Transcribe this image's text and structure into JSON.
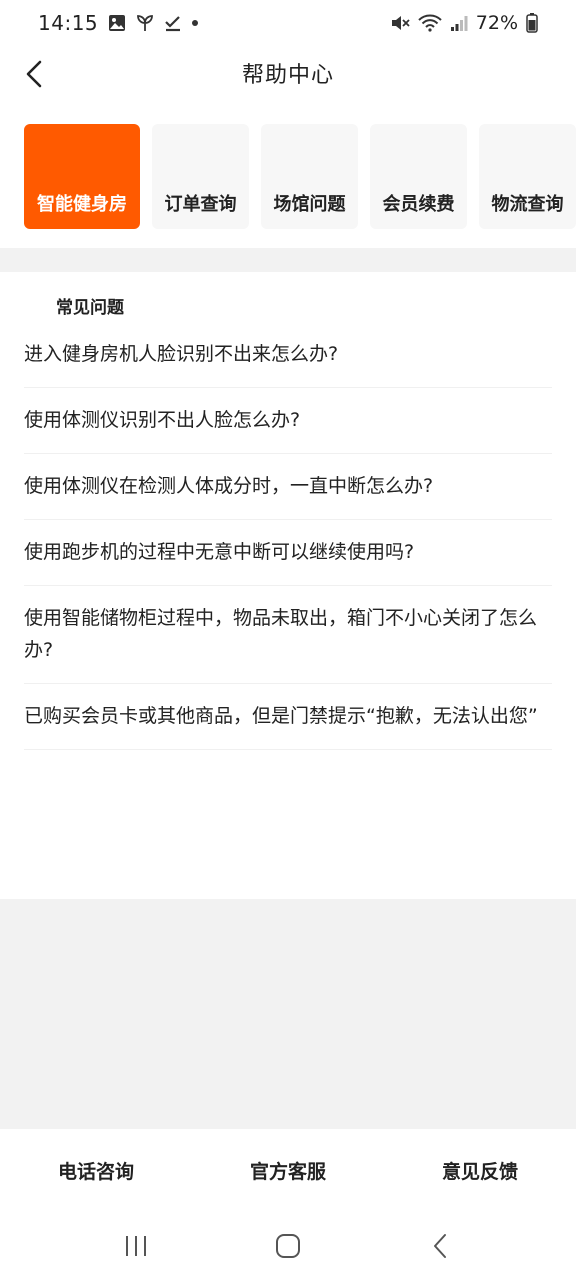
{
  "status_bar": {
    "time": "14:15",
    "battery": "72%",
    "icons": [
      "gallery-icon",
      "leaf-icon",
      "check-icon",
      "notification-dot-icon",
      "mute-icon",
      "wifi-icon",
      "signal-icon",
      "battery-icon"
    ]
  },
  "header": {
    "title": "帮助中心",
    "back_icon": "chevron-left-icon"
  },
  "tabs": [
    {
      "label": "智能健身房",
      "active": true
    },
    {
      "label": "订单查询",
      "active": false
    },
    {
      "label": "场馆问题",
      "active": false
    },
    {
      "label": "会员续费",
      "active": false
    },
    {
      "label": "物流查询",
      "active": false
    }
  ],
  "faq": {
    "title": "常见问题",
    "items": [
      "进入健身房机人脸识别不出来怎么办?",
      "使用体测仪识别不出人脸怎么办?",
      "使用体测仪在检测人体成分时，一直中断怎么办?",
      "使用跑步机的过程中无意中断可以继续使用吗?",
      "使用智能储物柜过程中，物品未取出，箱门不小心关闭了怎么办?",
      "已购买会员卡或其他商品，但是门禁提示“抱歉，无法认出您”"
    ]
  },
  "bottom_actions": {
    "phone": "电话咨询",
    "service": "官方客服",
    "feedback": "意见反馈"
  },
  "colors": {
    "accent": "#ff5a00",
    "tab_bg": "#f7f7f7",
    "band_gray": "#f2f2f2"
  }
}
